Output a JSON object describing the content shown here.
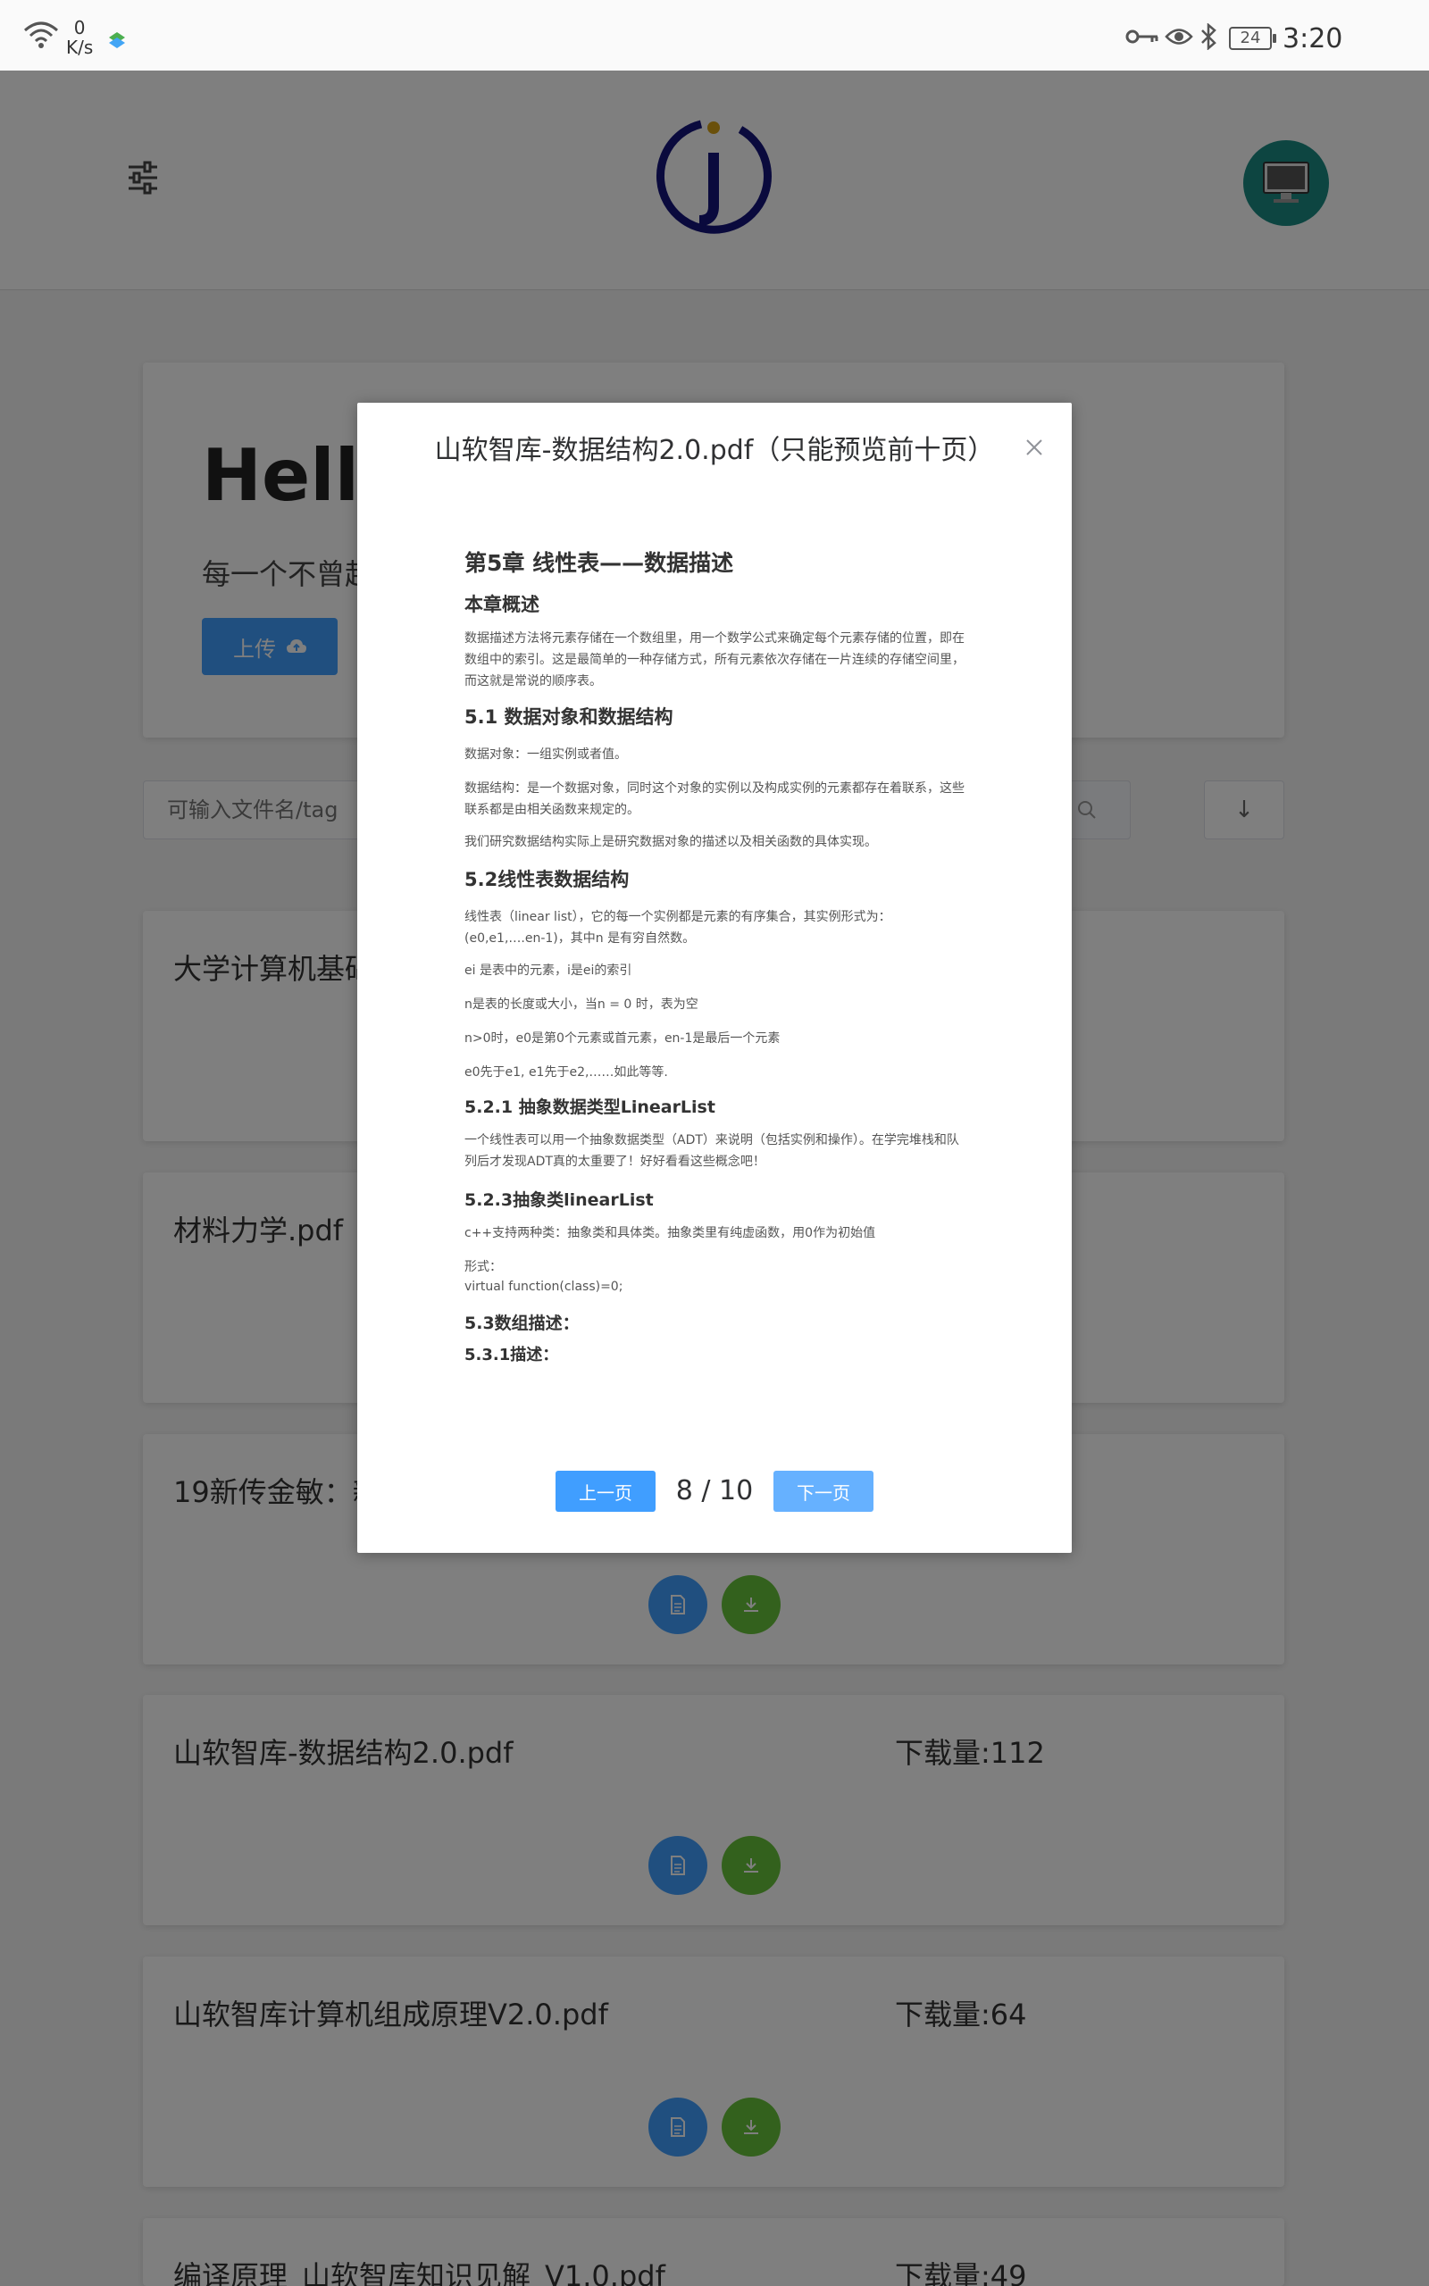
{
  "status_bar": {
    "speed_value": "0",
    "speed_unit": "K/s",
    "battery": "24",
    "time": "3:20"
  },
  "header": {
    "filter_icon": "sliders-icon",
    "logo": "j-logo",
    "avatar": "monitor-icon"
  },
  "hero": {
    "title": "Hello",
    "subtitle": "每一个不曾起",
    "upload_label": "上传"
  },
  "search": {
    "placeholder": "可输入文件名/tag",
    "sort_label": "↓"
  },
  "files": [
    {
      "name": "大学计算机基础",
      "downloads": ""
    },
    {
      "name": "材料力学.pdf",
      "downloads": ""
    },
    {
      "name": "19新传金敏：新",
      "downloads": ""
    },
    {
      "name": "山软智库-数据结构2.0.pdf",
      "downloads": "下载量:112"
    },
    {
      "name": "山软智库计算机组成原理V2.0.pdf",
      "downloads": "下载量:64"
    },
    {
      "name": "编译原理_山软智库知识见解_V1.0.pdf",
      "downloads": "下载量:49"
    }
  ],
  "dialog": {
    "title": "山软智库-数据结构2.0.pdf（只能预览前十页）",
    "prev_label": "上一页",
    "page_indicator": "8 / 10",
    "next_label": "下一页",
    "pdf": {
      "chapter": "第5章 线性表——数据描述",
      "overview_heading": "本章概述",
      "overview_text": "数据描述方法将元素存储在一个数组里，用一个数学公式来确定每个元素存储的位置，即在数组中的索引。这是最简单的一种存储方式，所有元素依次存储在一片连续的存储空间里，而这就是常说的顺序表。",
      "s51_heading": "5.1 数据对象和数据结构",
      "s51_p1": "数据对象：一组实例或者值。",
      "s51_p2": "数据结构：是一个数据对象，同时这个对象的实例以及构成实例的元素都存在着联系，这些联系都是由相关函数来规定的。",
      "s51_p3": "我们研究数据结构实际上是研究数据对象的描述以及相关函数的具体实现。",
      "s52_heading": "5.2线性表数据结构",
      "s52_p1": "线性表（linear list），它的每一个实例都是元素的有序集合，其实例形式为：(e0,e1,….en-1)，其中n 是有穷自然数。",
      "s52_p2": "ei 是表中的元素，i是ei的索引",
      "s52_p3": "n是表的长度或大小，当n = 0 时，表为空",
      "s52_p4": "n>0时，e0是第0个元素或首元素，en-1是最后一个元素",
      "s52_p5": "e0先于e1, e1先于e2,……如此等等.",
      "s521_heading": "5.2.1 抽象数据类型LinearList",
      "s521_p1": "一个线性表可以用一个抽象数据类型（ADT）来说明（包括实例和操作）。在学完堆栈和队列后才发现ADT真的太重要了！好好看看这些概念吧！",
      "s523_heading": "5.2.3抽象类linearList",
      "s523_p1": "c++支持两种类：抽象类和具体类。抽象类里有纯虚函数，用0作为初始值",
      "s523_p2": "形式：",
      "s523_p3": "virtual function(class)=0;",
      "s53_heading": "5.3数组描述：",
      "s531_heading": "5.3.1描述："
    }
  }
}
